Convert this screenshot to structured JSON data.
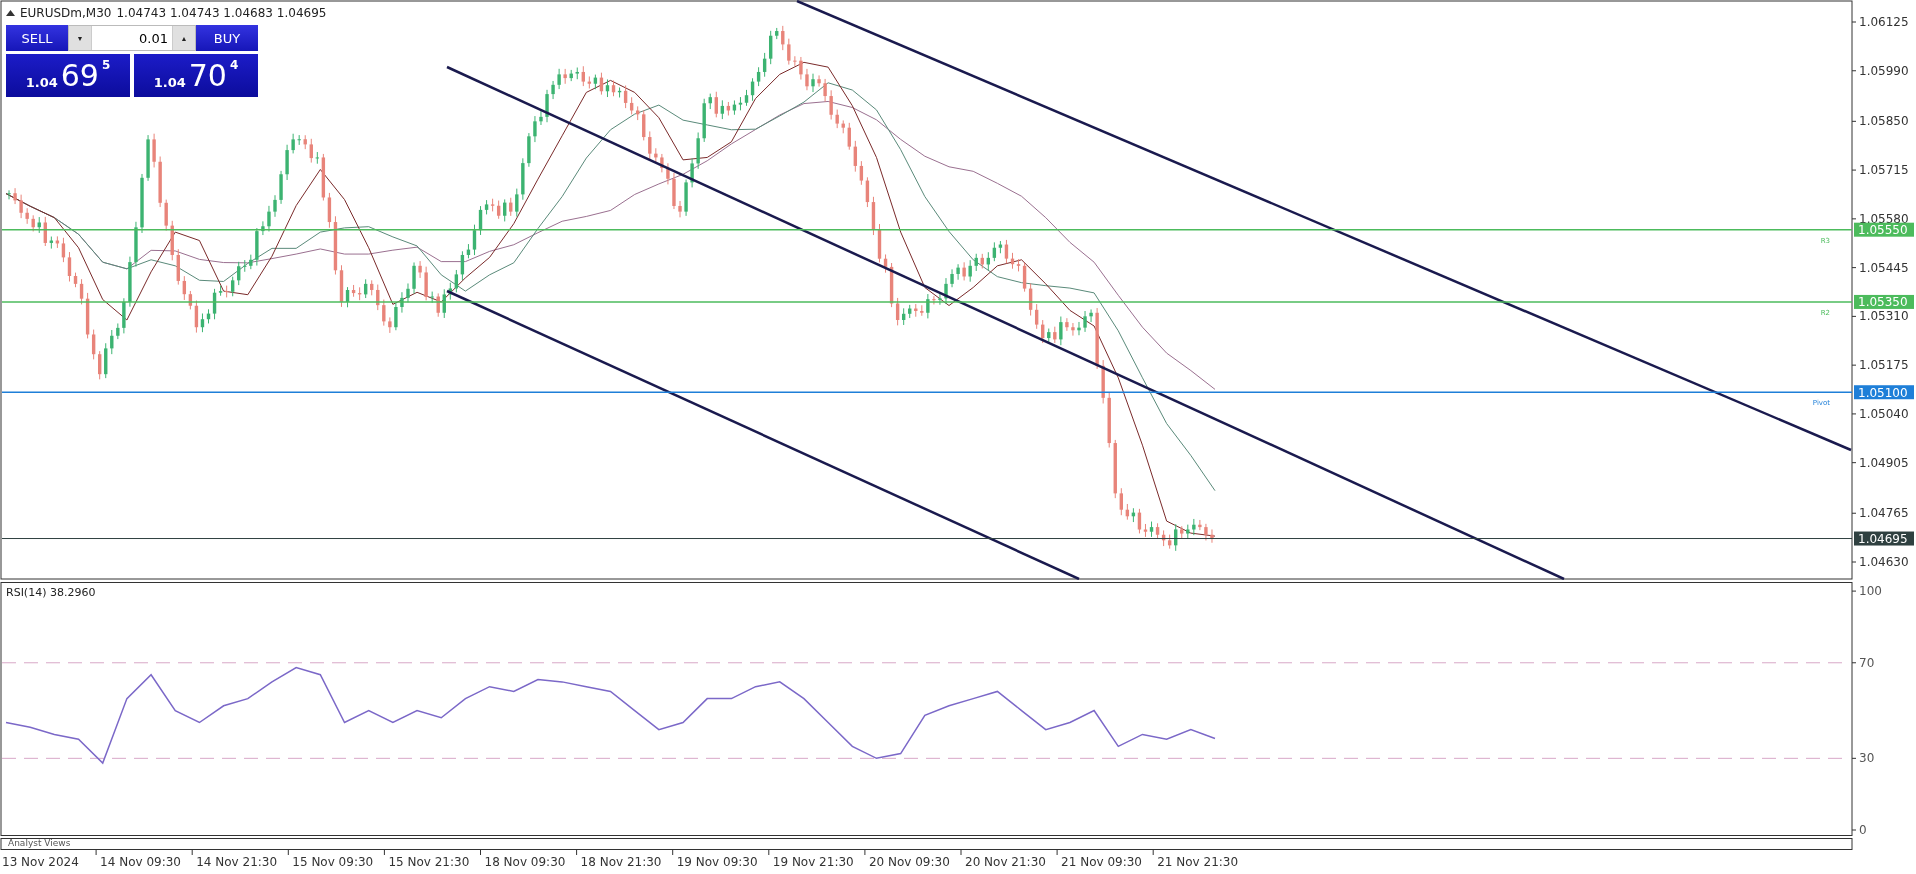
{
  "header": {
    "symbol": "EURUSDm,M30",
    "ohlc": "1.04743 1.04743 1.04683 1.04695"
  },
  "trade_panel": {
    "sell_label": "SELL",
    "buy_label": "BUY",
    "volume": "0.01",
    "down": "▼",
    "up": "▲",
    "sell_price": {
      "prefix": "1.04",
      "big": "69",
      "small": "5"
    },
    "buy_price": {
      "prefix": "1.04",
      "big": "70",
      "small": "4"
    }
  },
  "price_chart": {
    "price_axis": [
      "1.06125",
      "1.05990",
      "1.05850",
      "1.05715",
      "1.05580",
      "1.05445",
      "1.05310",
      "1.05175",
      "1.05040",
      "1.04905",
      "1.04765",
      "1.04630"
    ],
    "levels": [
      {
        "name": "R3",
        "price": "1.05550",
        "color": "#4cbb5c"
      },
      {
        "name": "R2",
        "price": "1.05350",
        "color": "#4cbb5c"
      },
      {
        "name": "Pivot",
        "price": "1.05100",
        "color": "#1e7fd8"
      },
      {
        "price": "1.04695",
        "color": "#2f4040"
      }
    ]
  },
  "rsi": {
    "value": "38.2960",
    "chart_data": {
      "type": "line",
      "ylim": [
        -2.3,
        103.6
      ],
      "yticks": [
        0,
        30,
        70,
        100
      ],
      "series": [
        {
          "name": "RSI(14)",
          "color": "#7b68c8",
          "values": [
            45,
            43,
            40,
            38,
            28,
            55,
            65,
            50,
            45,
            52,
            55,
            62,
            68,
            65,
            45,
            50,
            45,
            50,
            47,
            55,
            60,
            58,
            63,
            62,
            60,
            58,
            50,
            42,
            45,
            55,
            55,
            60,
            62,
            55,
            45,
            35,
            30,
            32,
            48,
            52,
            55,
            58,
            50,
            42,
            45,
            50,
            35,
            40,
            38,
            42,
            38.3
          ]
        }
      ]
    }
  },
  "analyst_pane": {
    "label": "Analyst Views"
  },
  "time_axis": [
    "13 Nov 2024",
    "14 Nov 09:30",
    "14 Nov 21:30",
    "15 Nov 09:30",
    "15 Nov 21:30",
    "18 Nov 09:30",
    "18 Nov 21:30",
    "19 Nov 09:30",
    "19 Nov 21:30",
    "20 Nov 09:30",
    "20 Nov 21:30",
    "21 Nov 09:30",
    "21 Nov 21:30"
  ]
}
